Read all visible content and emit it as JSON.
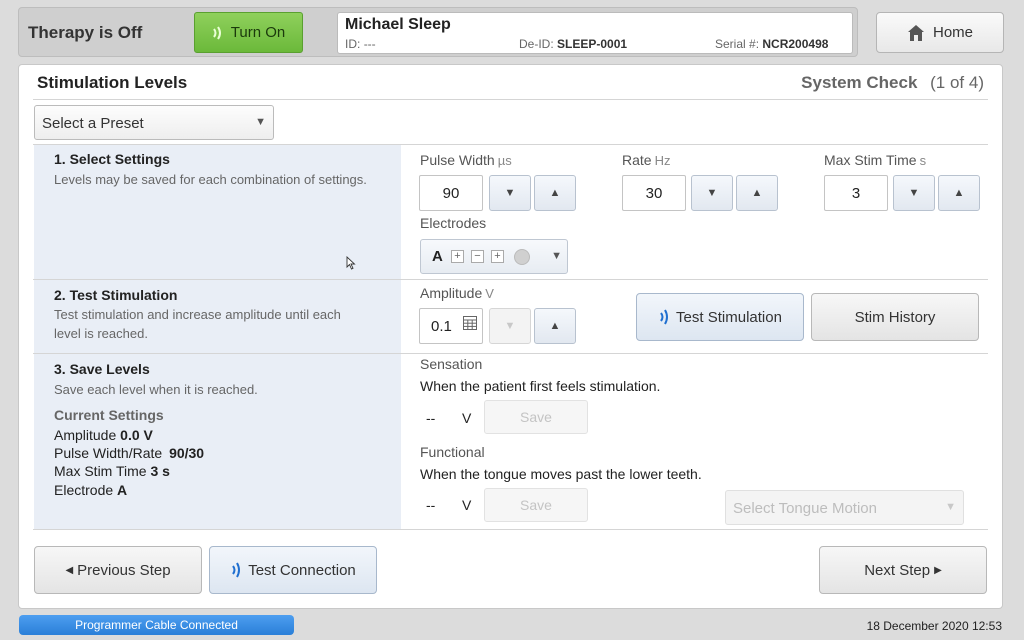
{
  "header": {
    "therapy_status": "Therapy is Off",
    "turn_on_label": "Turn On",
    "patient_name": "Michael Sleep",
    "id_label": "ID:",
    "id_value": "---",
    "deid_label": "De-ID:",
    "deid_value": "SLEEP-0001",
    "serial_label": "Serial #:",
    "serial_value": "NCR200498",
    "home_label": "Home"
  },
  "panel": {
    "title": "Stimulation Levels",
    "system_check_label": "System Check",
    "system_check_step": "(1 of 4)",
    "preset_placeholder": "Select a Preset"
  },
  "section1": {
    "title": "1. Select Settings",
    "desc": "Levels may be saved for each combination of settings.",
    "pulse_width_label": "Pulse Width",
    "pulse_width_unit": "µs",
    "pulse_width_value": "90",
    "rate_label": "Rate",
    "rate_unit": "Hz",
    "rate_value": "30",
    "max_stim_label": "Max Stim Time",
    "max_stim_unit": "s",
    "max_stim_value": "3",
    "electrodes_label": "Electrodes",
    "electrode_value": "A",
    "electrode_plus": "+",
    "electrode_minus": "−"
  },
  "section2": {
    "title": "2. Test Stimulation",
    "desc_line1": "Test stimulation and increase amplitude until each",
    "desc_line2": "level is reached.",
    "amplitude_label": "Amplitude",
    "amplitude_unit": "V",
    "amplitude_value": "0.1",
    "test_stim_label": "Test Stimulation",
    "stim_history_label": "Stim History"
  },
  "section3": {
    "title": "3. Save Levels",
    "desc": "Save each level when it is reached.",
    "sensation_label": "Sensation",
    "sensation_desc": "When the patient first feels stimulation.",
    "sensation_value": "--",
    "functional_label": "Functional",
    "functional_desc": "When the tongue moves past the lower teeth.",
    "functional_value": "--",
    "volt_unit": "V",
    "save_label": "Save",
    "tongue_placeholder": "Select Tongue Motion"
  },
  "current_settings": {
    "title": "Current Settings",
    "amplitude_label": "Amplitude",
    "amplitude_value": "0.0 V",
    "pw_rate_label": "Pulse Width/Rate",
    "pw_rate_value": "90/30",
    "max_stim_label": "Max Stim Time",
    "max_stim_value": "3 s",
    "electrode_label": "Electrode",
    "electrode_value": "A"
  },
  "footer": {
    "previous_label": "Previous Step",
    "test_connection_label": "Test Connection",
    "next_label": "Next Step",
    "status": "Programmer Cable Connected",
    "datetime": "18 December 2020 12:53"
  },
  "icons": {
    "wireless": "wireless-signal-icon",
    "home": "home-icon",
    "calculator": "keypad-icon",
    "arrow_left": "triangle-left-icon",
    "arrow_right": "triangle-right-icon"
  },
  "colors": {
    "turn_on": "#6bb93a",
    "status_bar": "#2a7fd8",
    "section_bg": "#e9eef6",
    "wireless_icon": "#1f6fd0"
  }
}
